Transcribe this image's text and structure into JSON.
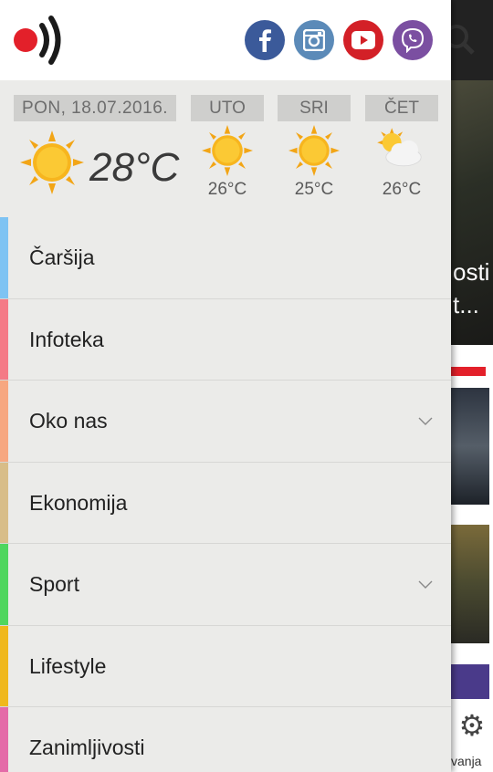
{
  "header": {
    "logo_icon": "broadcast-logo-icon",
    "social": [
      {
        "name": "facebook-icon",
        "color": "#3b5a9a"
      },
      {
        "name": "instagram-icon",
        "color": "#5b8ab8"
      },
      {
        "name": "youtube-icon",
        "color": "#d32027"
      },
      {
        "name": "viber-icon",
        "color": "#7b4fa1"
      }
    ]
  },
  "weather": {
    "date": "PON, 18.07.2016.",
    "current_temp": "28°C",
    "current_icon": "sun-icon",
    "forecast": [
      {
        "day": "UTO",
        "temp": "26°C",
        "icon": "sun-icon"
      },
      {
        "day": "SRI",
        "temp": "25°C",
        "icon": "sun-icon"
      },
      {
        "day": "ČET",
        "temp": "26°C",
        "icon": "partly-cloudy-icon"
      }
    ]
  },
  "menu": {
    "items": [
      {
        "label": "Čaršija",
        "color": "#7ec3f3",
        "expandable": false
      },
      {
        "label": "Infoteka",
        "color": "#f47a86",
        "expandable": false
      },
      {
        "label": "Oko nas",
        "color": "#f7a780",
        "expandable": true
      },
      {
        "label": "Ekonomija",
        "color": "#d8bd88",
        "expandable": false
      },
      {
        "label": "Sport",
        "color": "#4fd65e",
        "expandable": true
      },
      {
        "label": "Lifestyle",
        "color": "#f0b81c",
        "expandable": false
      },
      {
        "label": "Zanimljivosti",
        "color": "#e46aa8",
        "expandable": false
      }
    ]
  },
  "background": {
    "hero_text": "osti\nt...",
    "bottom_text": "vanja"
  }
}
